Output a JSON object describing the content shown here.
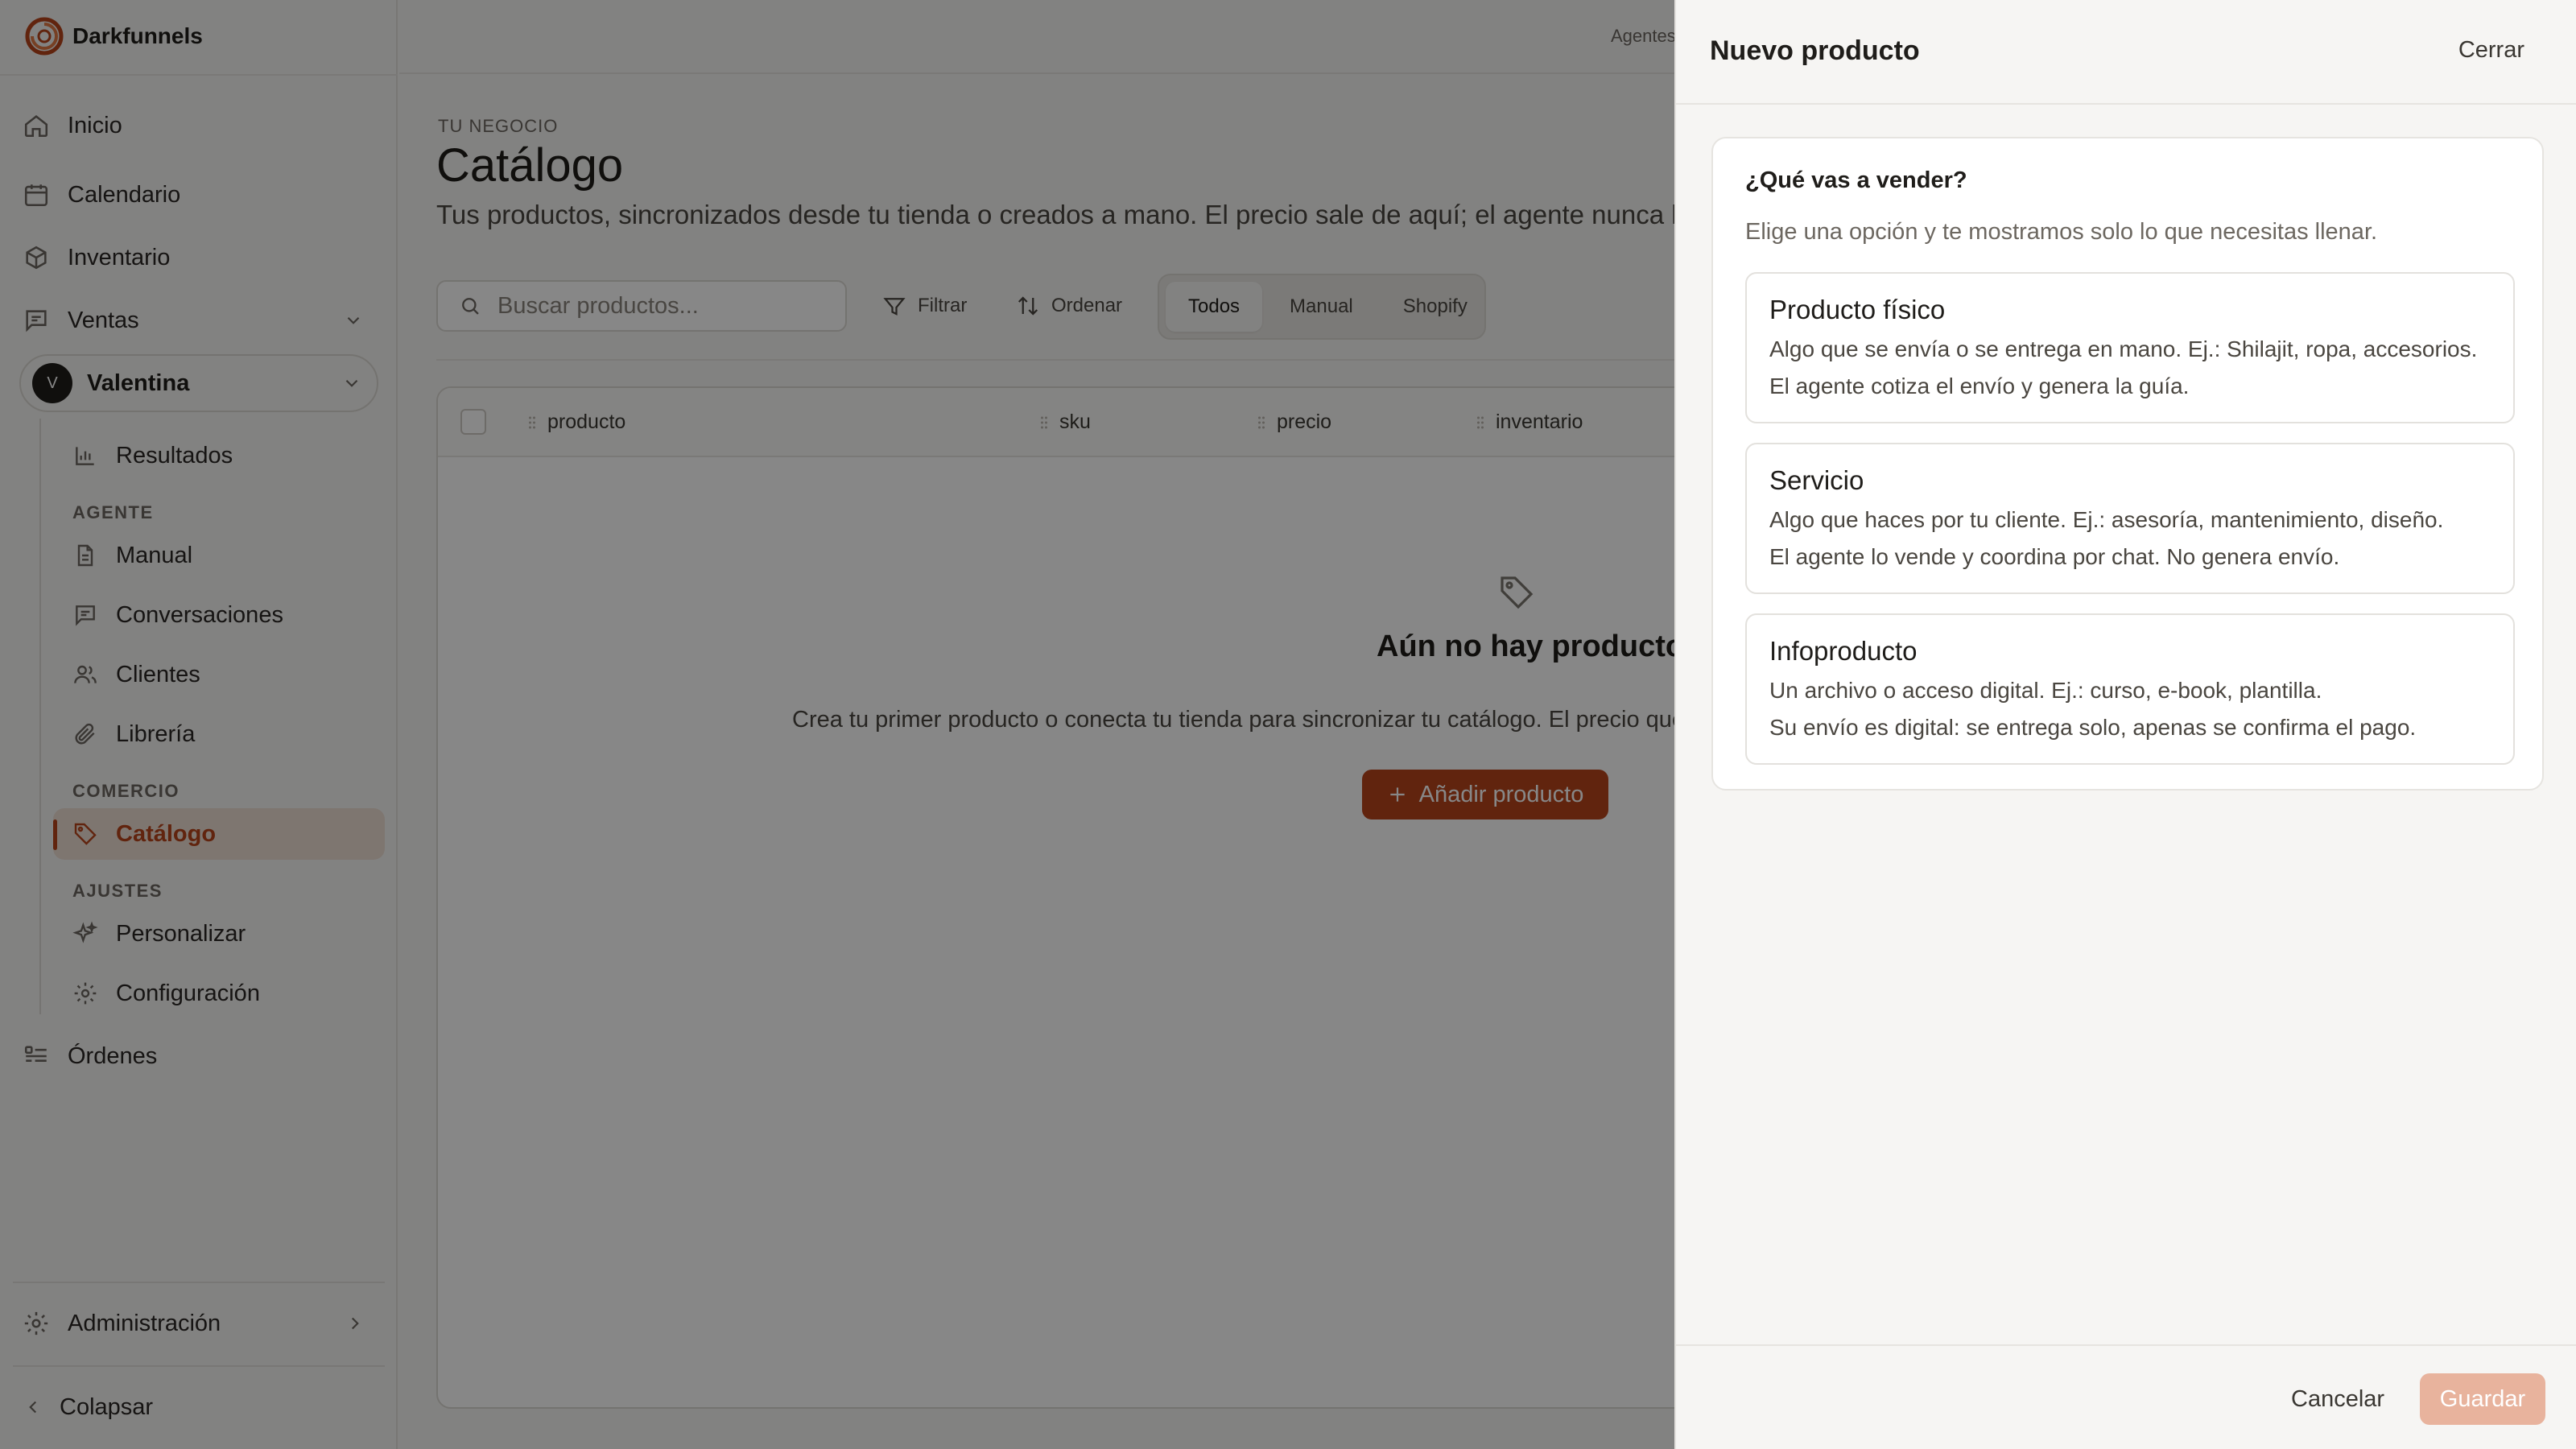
{
  "app": {
    "brand": "Darkfunnels",
    "accent": "#b8441c"
  },
  "sidebar": {
    "items": [
      {
        "label": "Inicio",
        "icon": "home-icon"
      },
      {
        "label": "Calendario",
        "icon": "calendar-icon"
      },
      {
        "label": "Inventario",
        "icon": "box-icon"
      },
      {
        "label": "Ventas",
        "icon": "chat-icon"
      }
    ],
    "user": {
      "initial": "V",
      "name": "Valentina"
    },
    "sub": {
      "resultados": "Resultados",
      "section_agente": "AGENTE",
      "manual": "Manual",
      "conversaciones": "Conversaciones",
      "clientes": "Clientes",
      "libreria": "Librería",
      "section_comercio": "COMERCIO",
      "catalogo": "Catálogo",
      "section_ajustes": "AJUSTES",
      "personalizar": "Personalizar",
      "configuracion": "Configuración"
    },
    "ordenes": "Órdenes",
    "administracion": "Administración",
    "colapsar": "Colapsar"
  },
  "header": {
    "agentes_link": "Agentes"
  },
  "page": {
    "eyebrow": "TU NEGOCIO",
    "title": "Catálogo",
    "subtitle": "Tus productos, sincronizados desde tu tienda o creados a mano. El precio sale de aquí; el agente nunca lo"
  },
  "toolbar": {
    "search_placeholder": "Buscar productos...",
    "filter": "Filtrar",
    "sort": "Ordenar",
    "segments": [
      "Todos",
      "Manual",
      "Shopify"
    ],
    "active_segment": "Todos"
  },
  "table": {
    "columns": [
      "producto",
      "sku",
      "precio",
      "inventario"
    ],
    "empty_title": "Aún no hay productos",
    "empty_text": "Crea tu primer producto o conecta tu tienda para sincronizar tu catálogo. El precio que",
    "add_button": "Añadir producto"
  },
  "drawer": {
    "title": "Nuevo producto",
    "close": "Cerrar",
    "question": "¿Qué vas a vender?",
    "question_sub": "Elige una opción y te mostramos solo lo que necesitas llenar.",
    "options": [
      {
        "title": "Producto físico",
        "line1": "Algo que se envía o se entrega en mano. Ej.: Shilajit, ropa, accesorios.",
        "line2": "El agente cotiza el envío y genera la guía."
      },
      {
        "title": "Servicio",
        "line1": "Algo que haces por tu cliente. Ej.: asesoría, mantenimiento, diseño.",
        "line2": "El agente lo vende y coordina por chat. No genera envío."
      },
      {
        "title": "Infoproducto",
        "line1": "Un archivo o acceso digital. Ej.: curso, e-book, plantilla.",
        "line2": "Su envío es digital: se entrega solo, apenas se confirma el pago."
      }
    ],
    "cancel": "Cancelar",
    "save": "Guardar"
  }
}
